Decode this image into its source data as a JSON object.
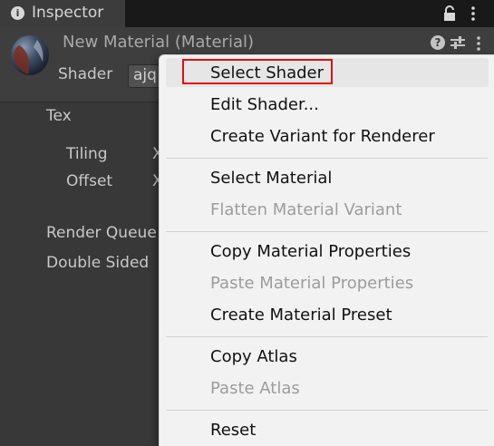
{
  "window": {
    "tab_title": "Inspector",
    "tab_icon": "info-icon",
    "tab_icon_glyph": "i",
    "actions": [
      "lock-icon",
      "kebab-menu-icon"
    ]
  },
  "material": {
    "name": "New Material (Material)",
    "shader_label": "Shader",
    "shader_value": "ajq",
    "help_glyph": "?"
  },
  "properties": {
    "tex": "Tex",
    "tiling": "Tiling",
    "tiling_x": "X",
    "offset": "Offset",
    "offset_x": "X",
    "render_queue": "Render Queue",
    "double_sided": "Double Sided"
  },
  "context_menu": {
    "items": [
      {
        "label": "Select Shader",
        "enabled": true,
        "highlighted": true
      },
      {
        "label": "Edit Shader...",
        "enabled": true
      },
      {
        "label": "Create Variant for Renderer",
        "enabled": true
      },
      {
        "label": "Select Material",
        "enabled": true
      },
      {
        "label": "Flatten Material Variant",
        "enabled": false
      },
      {
        "label": "Copy Material Properties",
        "enabled": true
      },
      {
        "label": "Paste Material Properties",
        "enabled": false
      },
      {
        "label": "Create Material Preset",
        "enabled": true
      },
      {
        "label": "Copy Atlas",
        "enabled": true
      },
      {
        "label": "Paste Atlas",
        "enabled": false
      },
      {
        "label": "Reset",
        "enabled": true
      }
    ]
  },
  "colors": {
    "panel_bg": "#383838",
    "menu_bg": "#f2f2f2",
    "highlight_outline": "#e01010",
    "disabled_text": "#9c9c9c"
  }
}
